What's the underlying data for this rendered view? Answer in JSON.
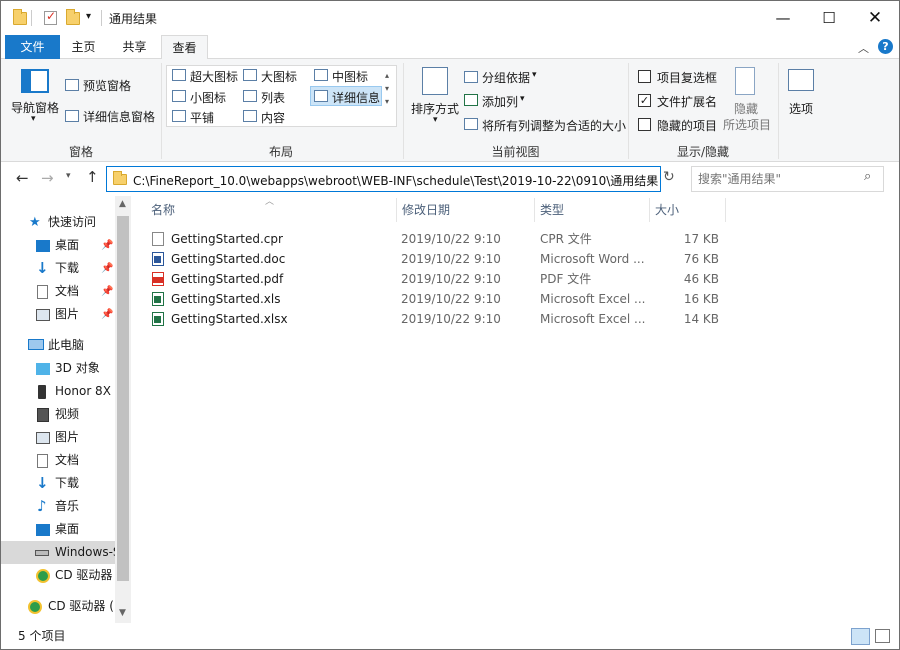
{
  "title": {
    "text": "通用结果"
  },
  "tabs": [
    {
      "label": "文件"
    },
    {
      "label": "主页"
    },
    {
      "label": "共享"
    },
    {
      "label": "查看"
    }
  ],
  "ribbon": {
    "panes": {
      "nav_pane": "导航窗格",
      "preview": "预览窗格",
      "details": "详细信息窗格",
      "group": "窗格"
    },
    "layout": {
      "items": [
        "超大图标",
        "大图标",
        "中图标",
        "小图标",
        "列表",
        "详细信息",
        "平铺",
        "内容"
      ],
      "group": "布局"
    },
    "current_view": {
      "sort": "排序方式",
      "group_by": "分组依据",
      "add_column": "添加列",
      "fit_columns": "将所有列调整为合适的大小",
      "group": "当前视图"
    },
    "show_hide": {
      "item_checkboxes": "项目复选框",
      "file_extensions": "文件扩展名",
      "hidden_items": "隐藏的项目",
      "hide_selected_1": "隐藏",
      "hide_selected_2": "所选项目",
      "options": "选项",
      "group": "显示/隐藏",
      "checked": {
        "item_checkboxes": false,
        "file_extensions": true,
        "hidden_items": false
      }
    }
  },
  "address": {
    "path": "C:\\FineReport_10.0\\webapps\\webroot\\WEB-INF\\schedule\\Test\\2019-10-22\\0910\\通用结果"
  },
  "search": {
    "placeholder": "搜索\"通用结果\""
  },
  "nav": {
    "quick_access": "快速访问",
    "quick_items": [
      "桌面",
      "下载",
      "文档",
      "图片"
    ],
    "this_pc": "此电脑",
    "pc_items": [
      "3D 对象",
      "Honor 8X",
      "视频",
      "图片",
      "文档",
      "下载",
      "音乐",
      "桌面",
      "Windows-S",
      "CD 驱动器"
    ],
    "cd_drive": "CD 驱动器 (D"
  },
  "columns": [
    "名称",
    "修改日期",
    "类型",
    "大小"
  ],
  "files": [
    {
      "name": "GettingStarted.cpr",
      "date": "2019/10/22 9:10",
      "type": "CPR 文件",
      "size": "17 KB",
      "icon": "file-icon"
    },
    {
      "name": "GettingStarted.doc",
      "date": "2019/10/22 9:10",
      "type": "Microsoft Word ...",
      "size": "76 KB",
      "icon": "word-icon"
    },
    {
      "name": "GettingStarted.pdf",
      "date": "2019/10/22 9:10",
      "type": "PDF 文件",
      "size": "46 KB",
      "icon": "pdf-icon"
    },
    {
      "name": "GettingStarted.xls",
      "date": "2019/10/22 9:10",
      "type": "Microsoft Excel ...",
      "size": "16 KB",
      "icon": "excel-icon"
    },
    {
      "name": "GettingStarted.xlsx",
      "date": "2019/10/22 9:10",
      "type": "Microsoft Excel ...",
      "size": "14 KB",
      "icon": "excel-icon"
    }
  ],
  "status": {
    "count": "5 个项目"
  },
  "colors": {
    "accent": "#1979ca",
    "word": "#2b579a",
    "excel": "#217346",
    "pdf": "#d93025"
  }
}
